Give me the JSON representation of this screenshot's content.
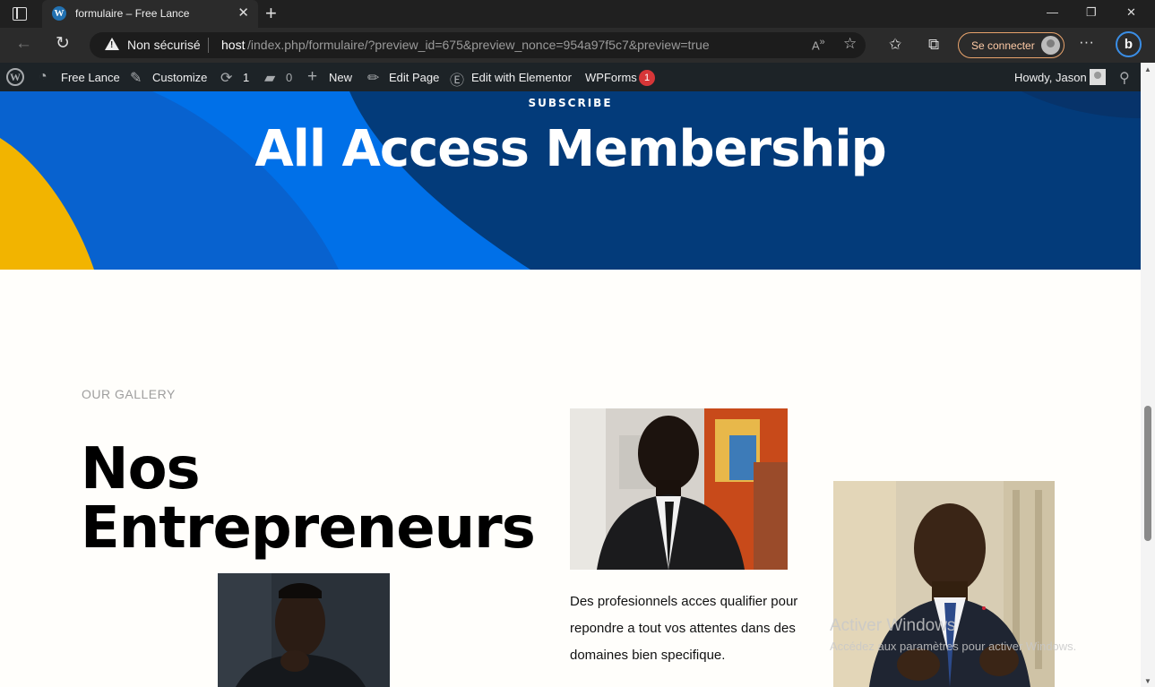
{
  "browser": {
    "tab_title": "formulaire – Free Lance",
    "security_label": "Non sécurisé",
    "url_host": "host",
    "url_path": "/index.php/formulaire/?preview_id=675&preview_nonce=954a97f5c7&preview=true",
    "signin_label": "Se connecter"
  },
  "adminbar": {
    "site_name": "Free Lance",
    "customize": "Customize",
    "updates_count": "1",
    "comments_count": "0",
    "new": "New",
    "edit_page": "Edit Page",
    "edit_elementor": "Edit with Elementor",
    "wpforms": "WPForms",
    "wpforms_badge": "1",
    "howdy": "Howdy, Jason"
  },
  "hero": {
    "eyebrow": "SUBSCRIBE",
    "title": "All Access Membership"
  },
  "gallery": {
    "label": "OUR GALLERY",
    "title_line1": "Nos",
    "title_line2": "Entrepreneurs",
    "description": "Des profesionnels acces qualifier pour repondre a tout vos attentes dans des domaines bien specifique."
  },
  "watermark": {
    "title": "Activer Windows",
    "subtitle": "Accédez aux paramètres pour activer Windows."
  },
  "colors": {
    "hero_dark": "#033b7a",
    "hero_blue": "#0070e8",
    "hero_yellow": "#f2b400",
    "admin_bar": "#1d2327"
  }
}
